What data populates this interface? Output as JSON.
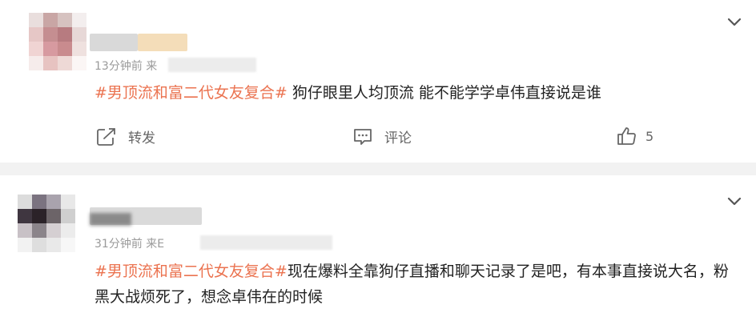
{
  "posts": [
    {
      "time": "13分钟前",
      "source_prefix": "来",
      "hashtag": "#男顶流和富二代女友复合#",
      "text": " 狗仔眼里人均顶流 能不能学学卓伟直接说是谁",
      "actions": {
        "repost_label": "转发",
        "comment_label": "评论",
        "like_count": "5"
      }
    },
    {
      "time": "31分钟前",
      "source_prefix": "来E",
      "hashtag": "#男顶流和富二代女友复合#",
      "text": "现在爆料全靠狗仔直播和聊天记录了是吧，有本事直接说大名，粉黑大战烦死了，想念卓伟在的时候"
    }
  ],
  "colors": {
    "hashtag": "#eb7350",
    "text": "#222222",
    "muted": "#9a9a9a",
    "separator": "#f2f2f2"
  },
  "icons": [
    "chevron-down-icon",
    "repost-icon",
    "comment-icon",
    "like-icon"
  ]
}
